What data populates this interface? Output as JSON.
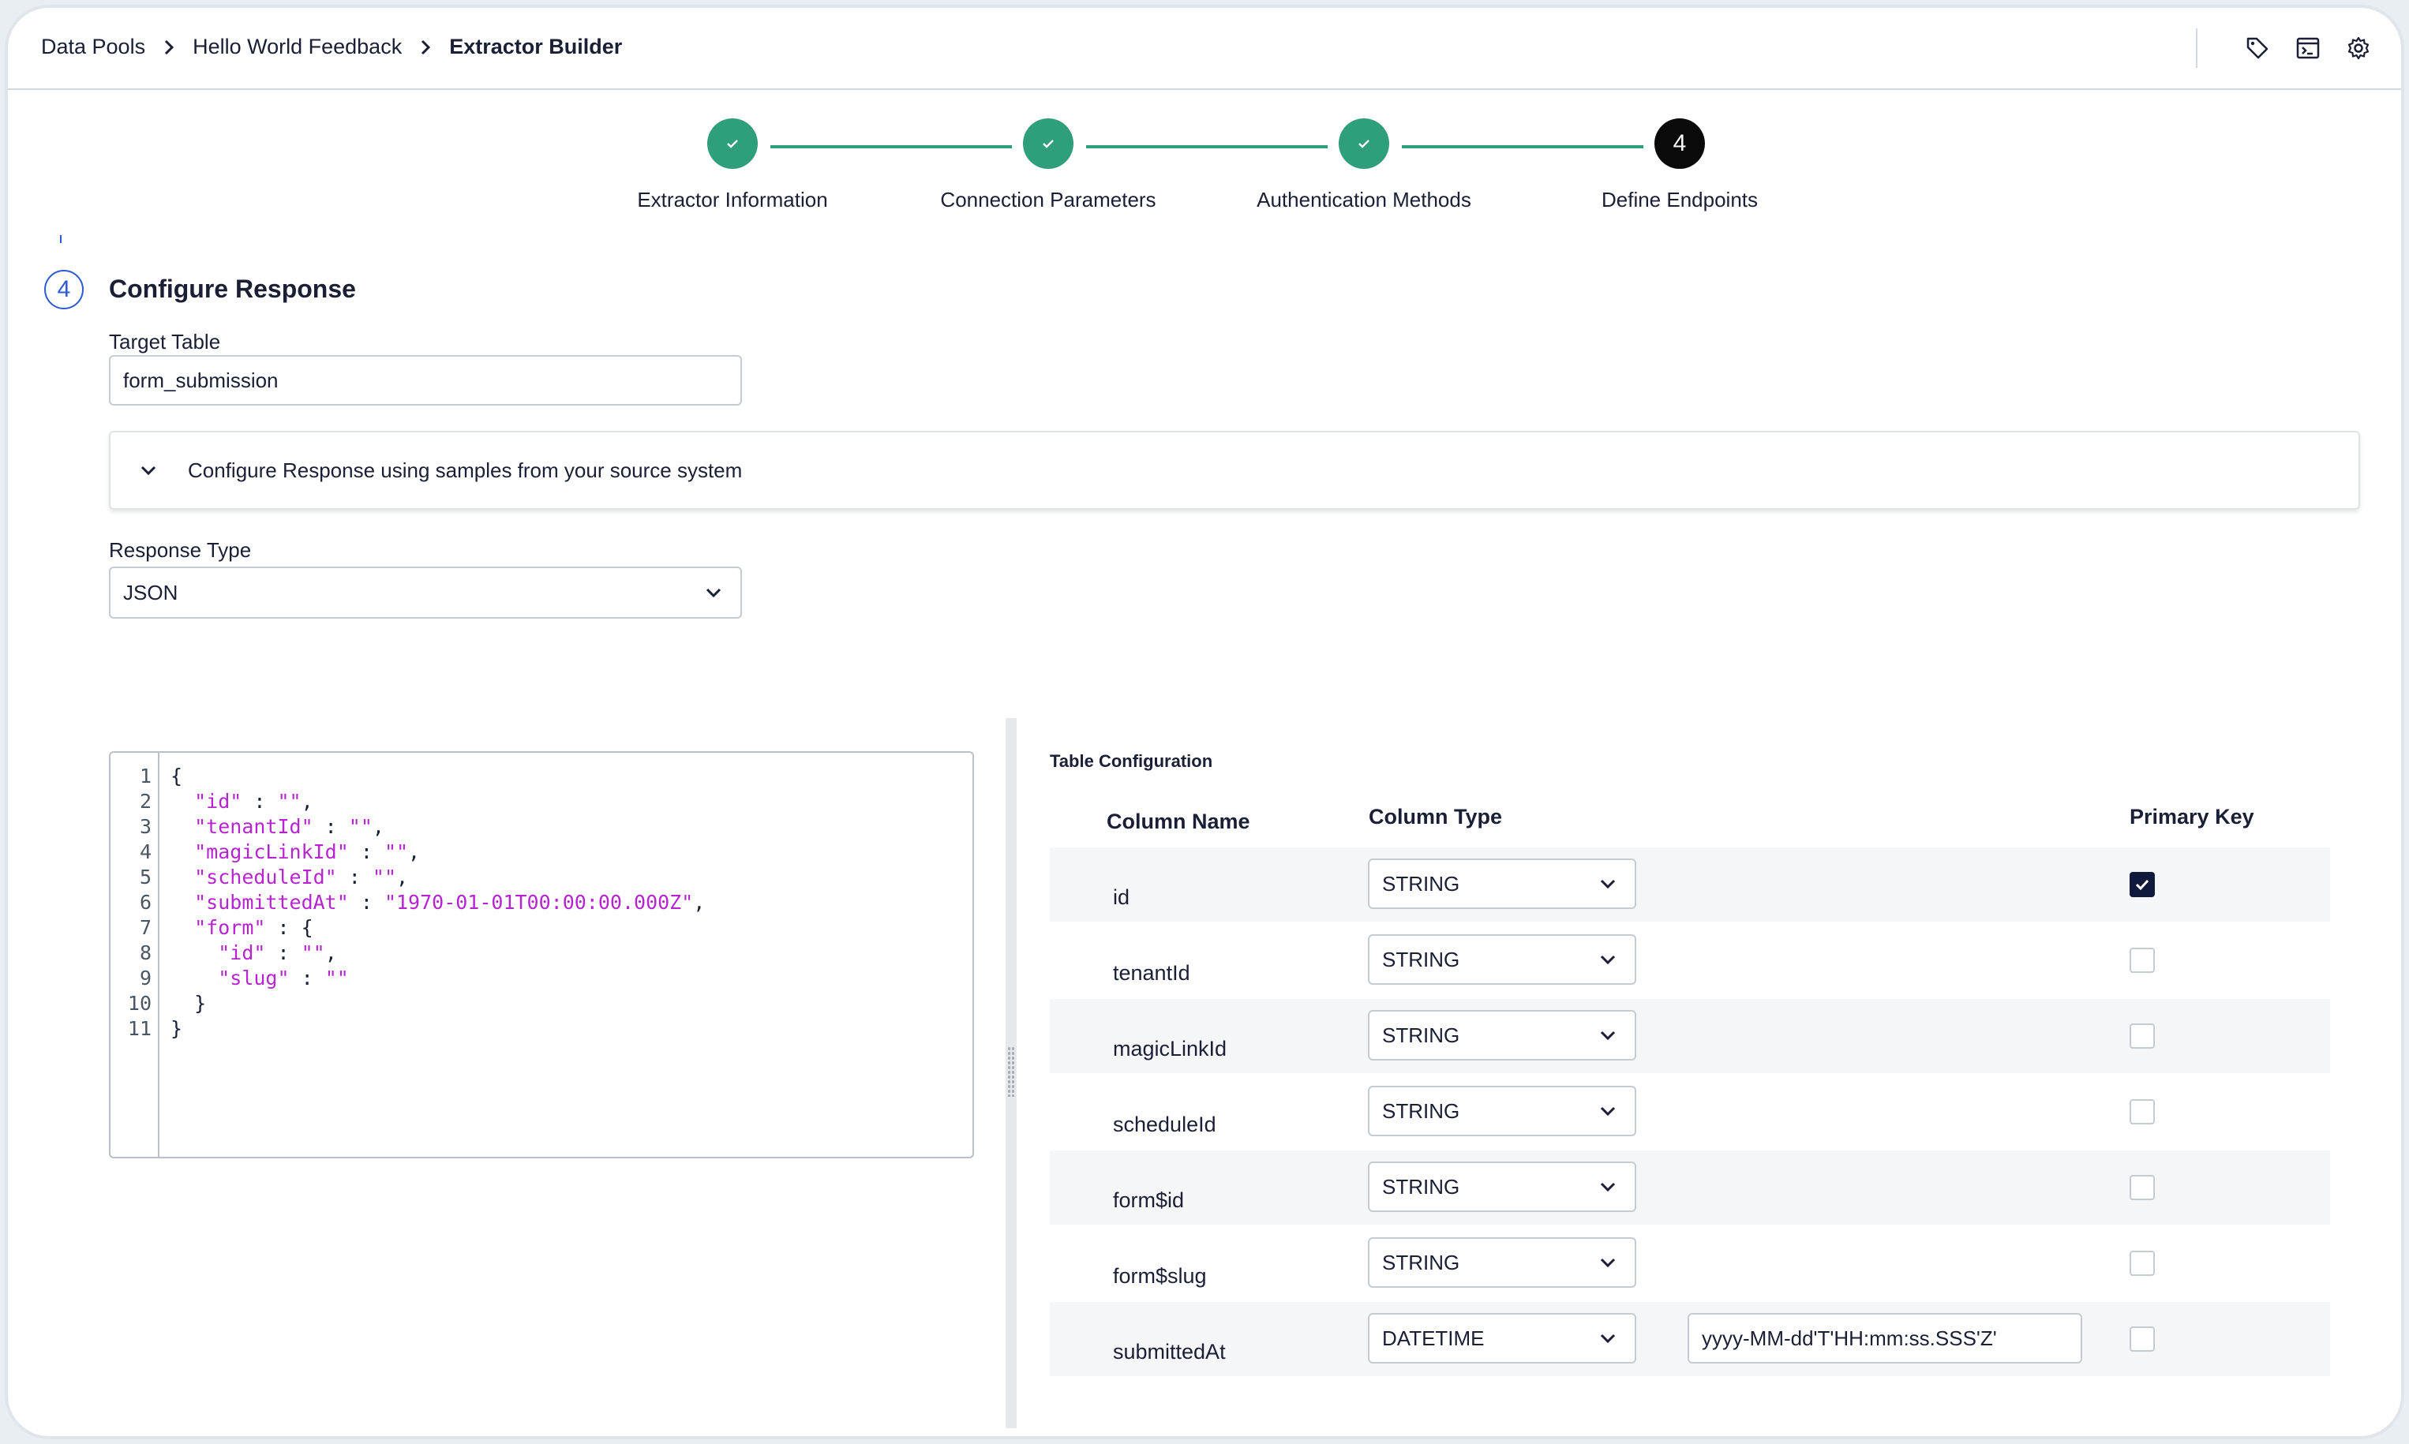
{
  "breadcrumb": [
    "Data Pools",
    "Hello World Feedback",
    "Extractor Builder"
  ],
  "top_icons": [
    "tag-icon",
    "terminal-icon",
    "gear-icon"
  ],
  "stepper": {
    "steps": [
      {
        "label": "Extractor Information",
        "state": "done"
      },
      {
        "label": "Connection Parameters",
        "state": "done"
      },
      {
        "label": "Authentication Methods",
        "state": "done"
      },
      {
        "label": "Define Endpoints",
        "state": "current",
        "number": "4"
      }
    ],
    "accent": "#2f9e7a"
  },
  "section": {
    "number": "4",
    "title": "Configure Response"
  },
  "target_table": {
    "label": "Target Table",
    "value": "form_submission"
  },
  "accordion": {
    "label": "Configure Response using samples from your source system"
  },
  "response_type": {
    "label": "Response Type",
    "value": "JSON"
  },
  "editor": {
    "line_numbers": [
      "1",
      "2",
      "3",
      "4",
      "5",
      "6",
      "7",
      "8",
      "9",
      "10",
      "11"
    ],
    "lines": [
      "{",
      "  \"id\" : \"\",",
      "  \"tenantId\" : \"\",",
      "  \"magicLinkId\" : \"\",",
      "  \"scheduleId\" : \"\",",
      "  \"submittedAt\" : \"1970-01-01T00:00:00.000Z\",",
      "  \"form\" : {",
      "    \"id\" : \"\",",
      "    \"slug\" : \"\"",
      "  }",
      "}"
    ]
  },
  "table_config": {
    "title": "Table Configuration",
    "headers": {
      "name": "Column Name",
      "type": "Column Type",
      "pk": "Primary Key"
    },
    "rows": [
      {
        "name": "id",
        "type": "STRING",
        "pk": true
      },
      {
        "name": "tenantId",
        "type": "STRING",
        "pk": false
      },
      {
        "name": "magicLinkId",
        "type": "STRING",
        "pk": false
      },
      {
        "name": "scheduleId",
        "type": "STRING",
        "pk": false
      },
      {
        "name": "form$id",
        "type": "STRING",
        "pk": false
      },
      {
        "name": "form$slug",
        "type": "STRING",
        "pk": false
      },
      {
        "name": "submittedAt",
        "type": "DATETIME",
        "pk": false,
        "format": "yyyy-MM-dd'T'HH:mm:ss.SSS'Z'"
      }
    ]
  }
}
